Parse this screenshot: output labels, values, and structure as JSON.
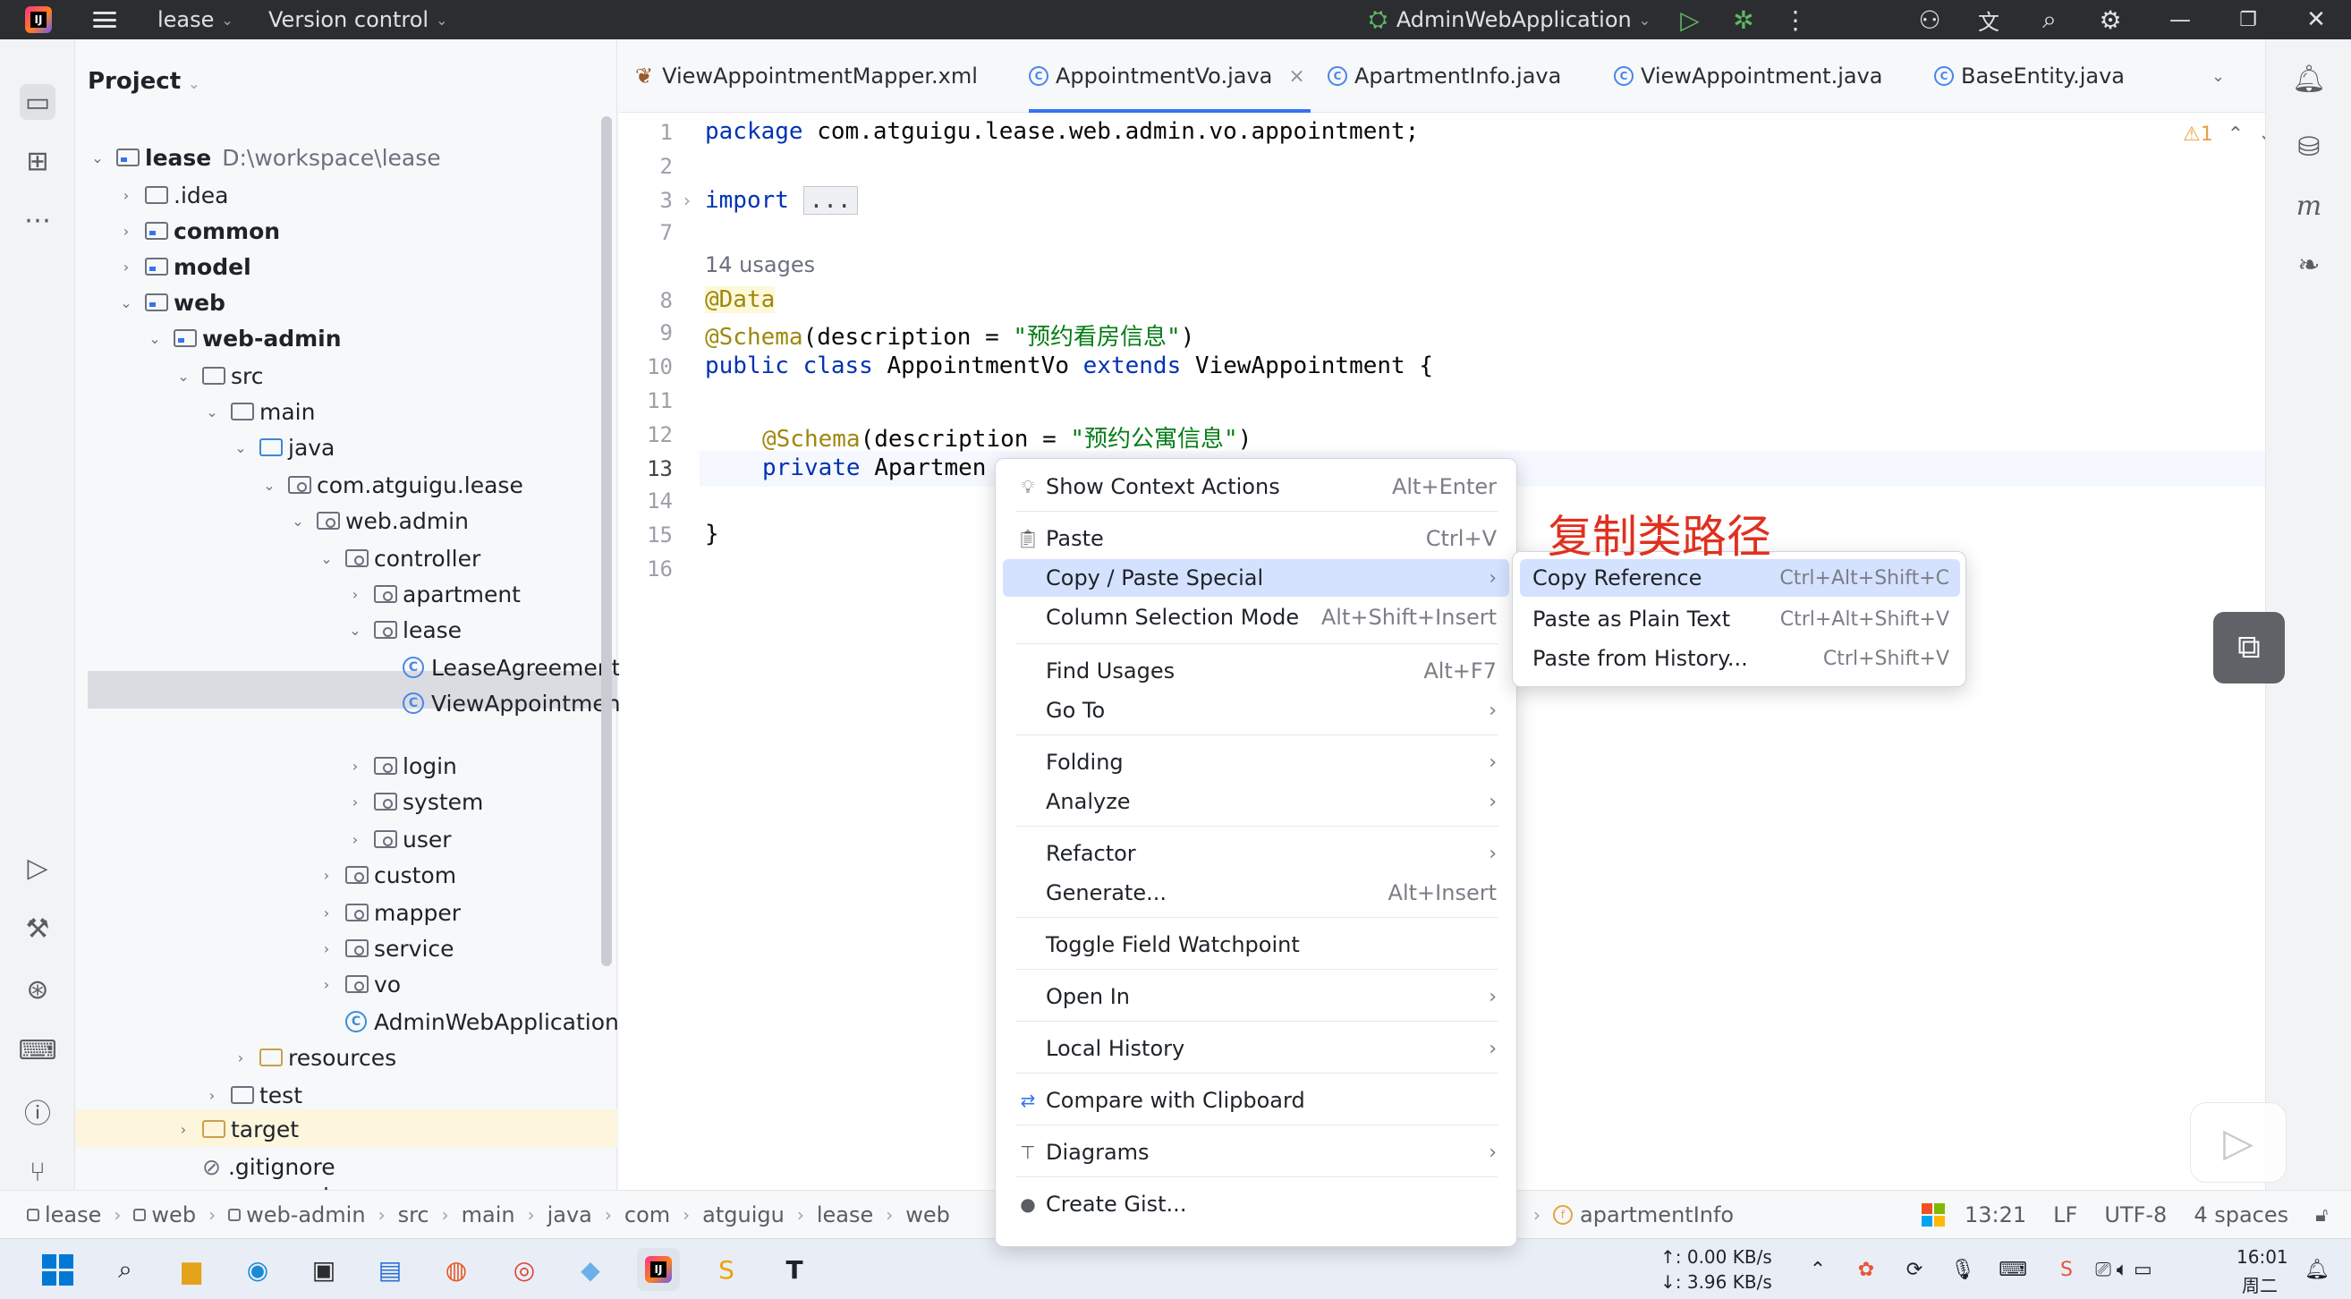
{
  "titlebar": {
    "project": "lease",
    "vcs": "Version control",
    "run_config": "AdminWebApplication"
  },
  "project_panel": {
    "title": "Project",
    "tree": [
      {
        "label": "lease",
        "extra": "D:\\workspace\\lease"
      },
      {
        "label": ".idea"
      },
      {
        "label": "common"
      },
      {
        "label": "model"
      },
      {
        "label": "web"
      },
      {
        "label": "web-admin"
      },
      {
        "label": "src"
      },
      {
        "label": "main"
      },
      {
        "label": "java"
      },
      {
        "label": "com.atguigu.lease"
      },
      {
        "label": "web.admin"
      },
      {
        "label": "controller"
      },
      {
        "label": "apartment"
      },
      {
        "label": "lease"
      },
      {
        "label": "LeaseAgreementC"
      },
      {
        "label": "ViewAppointment"
      },
      {
        "label": "login"
      },
      {
        "label": "system"
      },
      {
        "label": "user"
      },
      {
        "label": "custom"
      },
      {
        "label": "mapper"
      },
      {
        "label": "service"
      },
      {
        "label": "vo"
      },
      {
        "label": "AdminWebApplication"
      },
      {
        "label": "resources"
      },
      {
        "label": "test"
      },
      {
        "label": "target"
      },
      {
        "label": ".gitignore"
      },
      {
        "label": "pom.xml"
      }
    ]
  },
  "tabs": [
    {
      "label": "ViewAppointmentMapper.xml"
    },
    {
      "label": "AppointmentVo.java",
      "active": true
    },
    {
      "label": "ApartmentInfo.java"
    },
    {
      "label": "ViewAppointment.java"
    },
    {
      "label": "BaseEntity.java"
    }
  ],
  "editor": {
    "line_numbers": [
      "1",
      "2",
      "3",
      "7",
      "8",
      "9",
      "10",
      "11",
      "12",
      "13",
      "14",
      "15",
      "16"
    ],
    "usages": "14 usages",
    "warning_count": "1",
    "code": {
      "l1_kw": "package",
      "l1_rest": " com.atguigu.lease.web.admin.vo.appointment;",
      "l3_kw": "import",
      "l3_fold": "...",
      "l8_ann": "@Data",
      "l9_ann": "@Schema",
      "l9_a": "(description = ",
      "l9_str": "\"预约看房信息\"",
      "l9_b": ")",
      "l10_kw1": "public class",
      "l10_name": " AppointmentVo ",
      "l10_kw2": "extends",
      "l10_rest": " ViewAppointment {",
      "l12_ann": "@Schema",
      "l12_a": "(description = ",
      "l12_str": "\"预约公寓信息\"",
      "l12_b": ")",
      "l13_kw": "private",
      "l13_rest": " Apartmen",
      "l15": "}"
    }
  },
  "context_menu": {
    "items": [
      {
        "label": "Show Context Actions",
        "shortcut": "Alt+Enter"
      },
      {
        "label": "Paste",
        "shortcut": "Ctrl+V"
      },
      {
        "label": "Copy / Paste Special"
      },
      {
        "label": "Column Selection Mode",
        "shortcut": "Alt+Shift+Insert"
      },
      {
        "label": "Find Usages",
        "shortcut": "Alt+F7"
      },
      {
        "label": "Go To"
      },
      {
        "label": "Folding"
      },
      {
        "label": "Analyze"
      },
      {
        "label": "Refactor"
      },
      {
        "label": "Generate...",
        "shortcut": "Alt+Insert"
      },
      {
        "label": "Toggle Field Watchpoint"
      },
      {
        "label": "Open In"
      },
      {
        "label": "Local History"
      },
      {
        "label": "Compare with Clipboard"
      },
      {
        "label": "Diagrams"
      },
      {
        "label": "Create Gist..."
      }
    ]
  },
  "submenu": {
    "items": [
      {
        "label": "Copy Reference",
        "shortcut": "Ctrl+Alt+Shift+C"
      },
      {
        "label": "Paste as Plain Text",
        "shortcut": "Ctrl+Alt+Shift+V"
      },
      {
        "label": "Paste from History...",
        "shortcut": "Ctrl+Shift+V"
      }
    ]
  },
  "annotation": "复制类路径",
  "statusbar": {
    "breadcrumbs": [
      "lease",
      "web",
      "web-admin",
      "src",
      "main",
      "java",
      "com",
      "atguigu",
      "lease",
      "web"
    ],
    "field": "apartmentInfo",
    "position": "13:21",
    "line_sep": "LF",
    "encoding": "UTF-8",
    "indent": "4 spaces"
  },
  "taskbar": {
    "net_up": "↑: 0.00 KB/s",
    "net_down": "↓: 3.96 KB/s",
    "time": "16:01",
    "day": "周二"
  },
  "colors": {
    "accent": "#3574f0",
    "menu_highlight": "#d4e2ff",
    "annotation": "#e0301e"
  }
}
